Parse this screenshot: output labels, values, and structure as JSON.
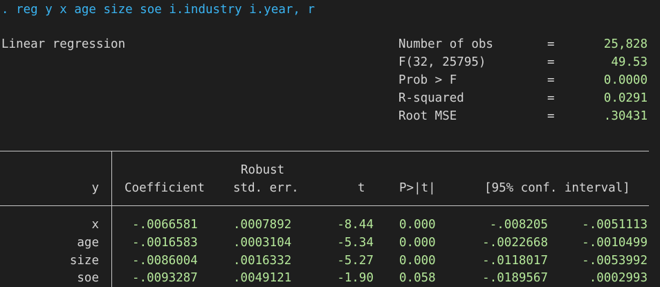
{
  "command": ". reg y x age size soe i.industry i.year, r",
  "title": "Linear regression",
  "stats": [
    {
      "label": "Number of obs",
      "eq": "=",
      "value": "25,828"
    },
    {
      "label": "F(32, 25795)",
      "eq": "=",
      "value": "49.53"
    },
    {
      "label": "Prob > F",
      "eq": "=",
      "value": "0.0000"
    },
    {
      "label": "R-squared",
      "eq": "=",
      "value": "0.0291"
    },
    {
      "label": "Root MSE",
      "eq": "=",
      "value": ".30431"
    }
  ],
  "table": {
    "header_top": "Robust",
    "depvar": "y",
    "columns": [
      "Coefficient",
      "std. err.",
      "t",
      "P>|t|",
      "[95% conf. interval]"
    ],
    "rows": [
      {
        "var": "x",
        "coef": "-.0066581",
        "se": ".0007892",
        "t": "-8.44",
        "p": "0.000",
        "lo": "-.008205",
        "hi": "-.0051113"
      },
      {
        "var": "age",
        "coef": "-.0016583",
        "se": ".0003104",
        "t": "-5.34",
        "p": "0.000",
        "lo": "-.0022668",
        "hi": "-.0010499"
      },
      {
        "var": "size",
        "coef": "-.0086004",
        "se": ".0016332",
        "t": "-5.27",
        "p": "0.000",
        "lo": "-.0118017",
        "hi": "-.0053992"
      },
      {
        "var": "soe",
        "coef": "-.0093287",
        "se": ".0049121",
        "t": "-1.90",
        "p": "0.058",
        "lo": "-.0189567",
        "hi": ".0002993"
      }
    ]
  },
  "colors": {
    "background": "#1e1e1e",
    "command": "#3ab4f2",
    "text": "#d4d4d4",
    "value": "#b5e89a",
    "rule": "#c8c8c8"
  }
}
